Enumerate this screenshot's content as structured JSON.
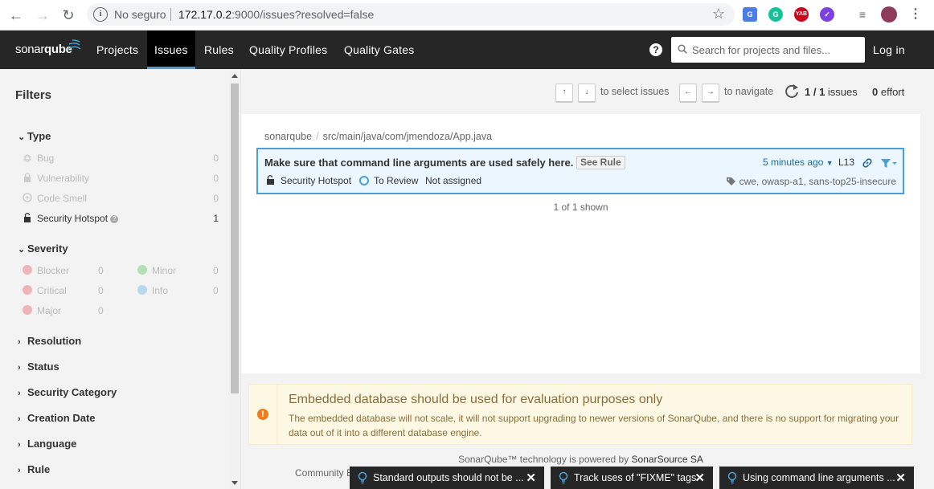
{
  "browser": {
    "security_label": "No seguro",
    "url_host": "172.17.0.2",
    "url_path": ":9000/issues?resolved=false"
  },
  "nav": {
    "logo_left": "sonar",
    "logo_right": "qube",
    "items": [
      {
        "label": "Projects"
      },
      {
        "label": "Issues",
        "active": true
      },
      {
        "label": "Rules"
      },
      {
        "label": "Quality Profiles"
      },
      {
        "label": "Quality Gates"
      }
    ],
    "search_placeholder": "Search for projects and files...",
    "login": "Log in"
  },
  "sidebar": {
    "title": "Filters",
    "type": {
      "heading": "Type",
      "items": [
        {
          "label": "Bug",
          "count": "0",
          "icon": "bug-icon"
        },
        {
          "label": "Vulnerability",
          "count": "0",
          "icon": "lock-icon"
        },
        {
          "label": "Code Smell",
          "count": "0",
          "icon": "code-smell-icon"
        },
        {
          "label": "Security Hotspot",
          "count": "1",
          "icon": "security-hotspot-icon"
        }
      ]
    },
    "severity": {
      "heading": "Severity",
      "left": [
        {
          "label": "Blocker",
          "count": "0",
          "color": "#d4333f"
        },
        {
          "label": "Critical",
          "count": "0",
          "color": "#d4333f"
        },
        {
          "label": "Major",
          "count": "0",
          "color": "#d4333f"
        }
      ],
      "right": [
        {
          "label": "Minor",
          "count": "0",
          "color": "#00aa00"
        },
        {
          "label": "Info",
          "count": "0",
          "color": "#4b9fd5"
        }
      ]
    },
    "collapsed": [
      "Resolution",
      "Status",
      "Security Category",
      "Creation Date",
      "Language",
      "Rule"
    ]
  },
  "toolbar": {
    "select_hint": "to select issues",
    "navigate_hint": "to navigate",
    "issues_count": "1 / 1",
    "issues_label": "issues",
    "effort_value": "0",
    "effort_label": "effort"
  },
  "main": {
    "breadcrumb": [
      "sonarqube",
      "src/main/java/com/jmendoza/App.java"
    ],
    "issue": {
      "message": "Make sure that command line arguments are used safely here.",
      "see_rule": "See Rule",
      "time": "5 minutes ago",
      "line": "L13",
      "type": "Security Hotspot",
      "status": "To Review",
      "assignee": "Not assigned",
      "tags": "cwe, owasp-a1, sans-top25-insecure"
    },
    "shown": "1 of 1 shown"
  },
  "warning": {
    "title": "Embedded database should be used for evaluation purposes only",
    "body": "The embedded database will not scale, it will not support upgrading to newer versions of SonarQube, and there is no support for migrating your data out of it into a different database engine."
  },
  "footer": {
    "powered_prefix": "SonarQube™ technology is powered by",
    "powered_link": "SonarSource SA",
    "edition_fragment": "Community E"
  },
  "toasts": [
    {
      "text": "Standard outputs should not be ..."
    },
    {
      "text": "Track uses of \"FIXME\" tags"
    },
    {
      "text": "Using command line arguments ..."
    }
  ]
}
